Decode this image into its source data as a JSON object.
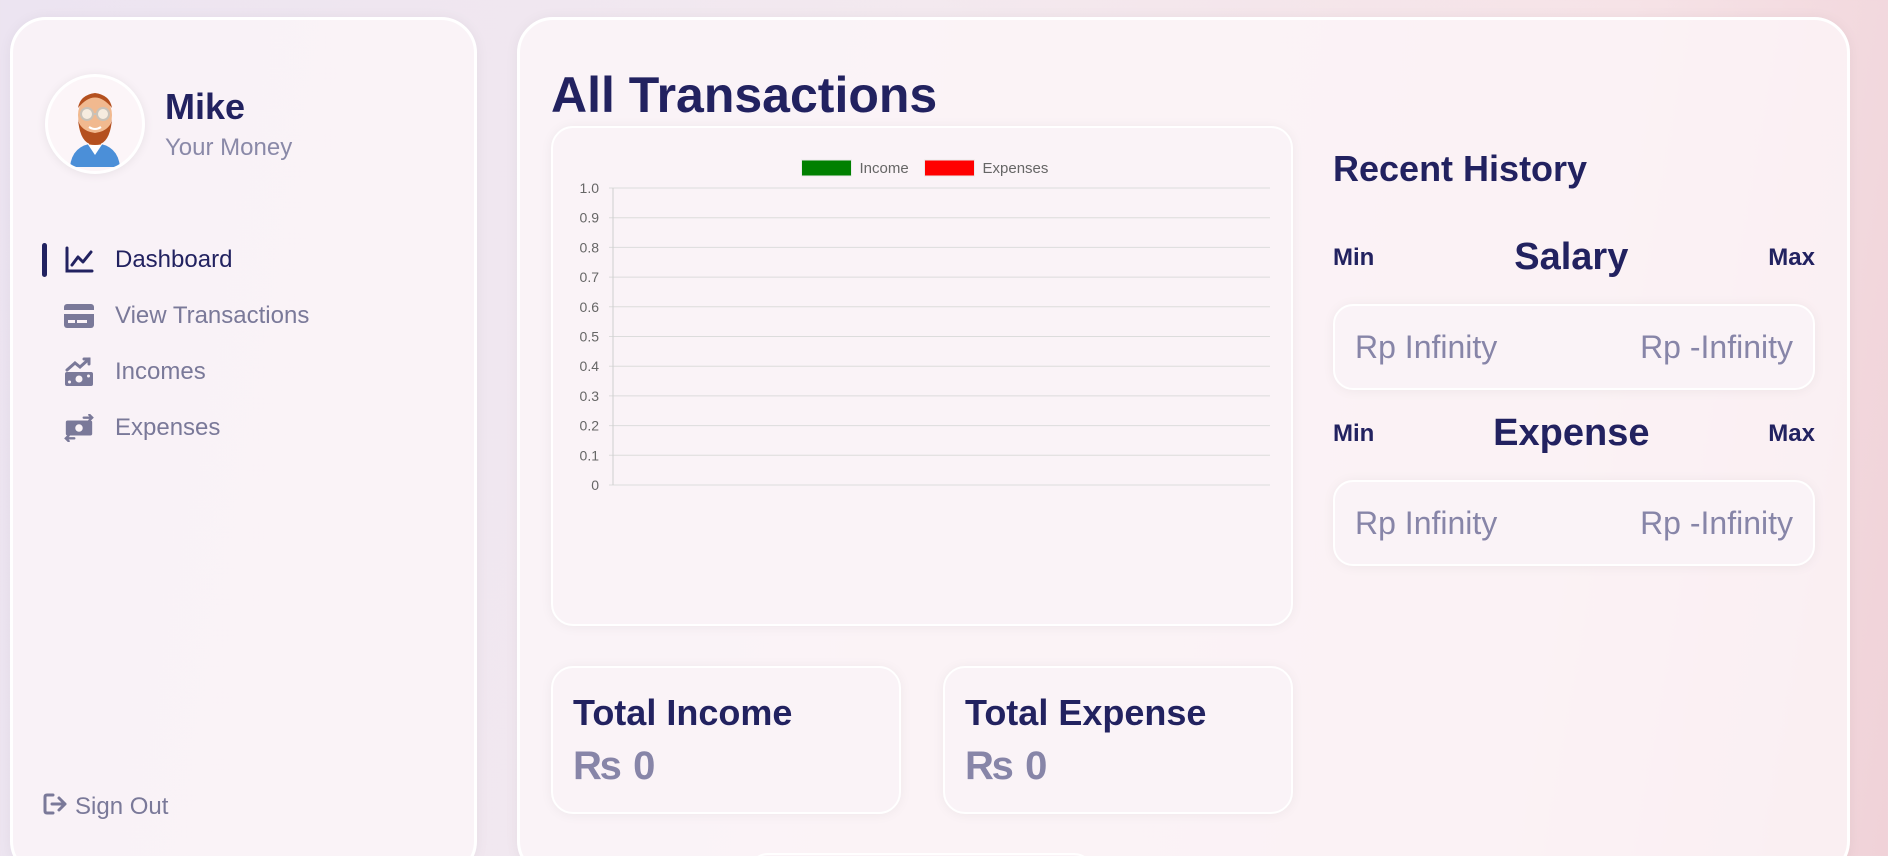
{
  "profile": {
    "name": "Mike",
    "subtitle": "Your Money",
    "avatar_icon": "avatar-icon"
  },
  "menu": {
    "items": [
      {
        "label": "Dashboard",
        "icon": "chart-line-icon",
        "active": true
      },
      {
        "label": "View Transactions",
        "icon": "credit-card-icon",
        "active": false
      },
      {
        "label": "Incomes",
        "icon": "money-trend-icon",
        "active": false
      },
      {
        "label": "Expenses",
        "icon": "money-exchange-icon",
        "active": false
      }
    ]
  },
  "signout": {
    "label": "Sign Out",
    "icon": "sign-out-icon"
  },
  "main": {
    "title": "All Transactions"
  },
  "chart_data": {
    "type": "line",
    "categories": [],
    "series": [
      {
        "name": "Income",
        "values": [],
        "color": "#008000"
      },
      {
        "name": "Expenses",
        "values": [],
        "color": "#ff0000"
      }
    ],
    "ylim": [
      0,
      1.0
    ],
    "yticks": [
      "1.0",
      "0.9",
      "0.8",
      "0.7",
      "0.6",
      "0.5",
      "0.4",
      "0.3",
      "0.2",
      "0.1",
      "0"
    ],
    "grid": true,
    "legend": "top-center"
  },
  "totals": {
    "income": {
      "title": "Total Income",
      "value": "₨ 0"
    },
    "expense": {
      "title": "Total Expense",
      "value": "₨ 0"
    }
  },
  "history": {
    "title": "Recent History",
    "salary": {
      "label": "Salary",
      "min_label": "Min",
      "max_label": "Max",
      "min_value": "Rp Infinity",
      "max_value": "Rp -Infinity"
    },
    "expense": {
      "label": "Expense",
      "min_label": "Min",
      "max_label": "Max",
      "min_value": "Rp Infinity",
      "max_value": "Rp -Infinity"
    }
  },
  "colors": {
    "primary": "#222260",
    "muted": "#8785a8",
    "income": "#008000",
    "expense": "#ff0000"
  }
}
